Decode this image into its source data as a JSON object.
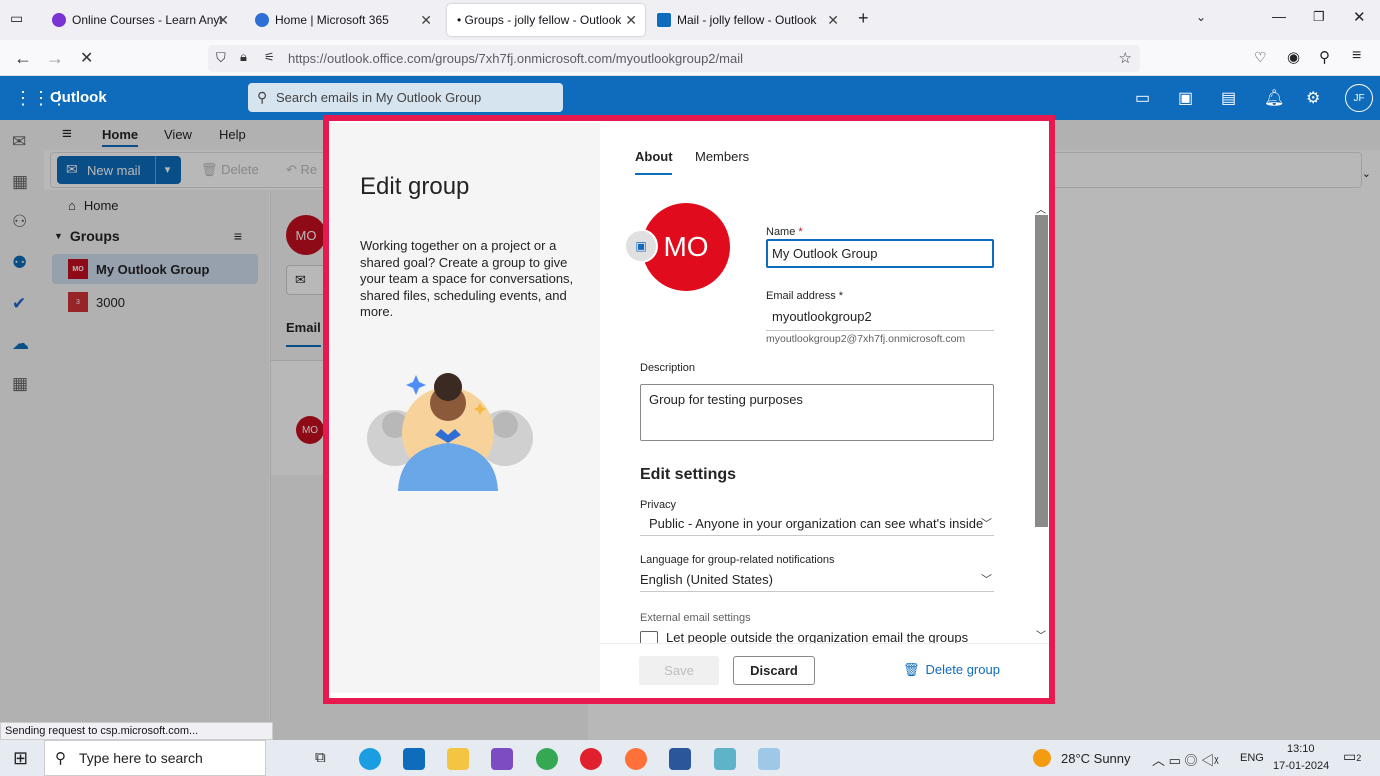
{
  "browser": {
    "tabs": [
      {
        "title": "Online Courses - Learn Anything",
        "fav": "#7b34d4"
      },
      {
        "title": "Home | Microsoft 365",
        "fav": "#2e6fd6"
      },
      {
        "title": "• Groups - jolly fellow - Outlook",
        "fav": ""
      },
      {
        "title": "Mail - jolly fellow - Outlook",
        "fav": "#0f6cbd"
      }
    ],
    "url": "https://outlook.office.com/groups/7xh7fj.onmicrosoft.com/myoutlookgroup2/mail",
    "status": "Sending request to csp.microsoft.com..."
  },
  "outlook": {
    "brand": "Outlook",
    "search_placeholder": "Search emails in My Outlook Group",
    "avatar": "JF",
    "ribbon_tabs": [
      "Home",
      "View",
      "Help"
    ],
    "new_mail": "New mail",
    "delete": "Delete",
    "reply": "Re",
    "home": "Home",
    "groups": "Groups",
    "group1": "My Outlook Group",
    "group1_badge": "MO",
    "group2": "3000",
    "group2_badge": "3",
    "email_tab": "Email",
    "mo": "MO"
  },
  "dialog": {
    "title": "Edit group",
    "description": "Working together on a project or a shared goal? Create a group to give your team a space for conversations, shared files, scheduling events, and more.",
    "tabs": [
      "About",
      "Members"
    ],
    "avatar": "MO",
    "name_label": "Name",
    "name_value": "My Outlook Group",
    "email_label": "Email address",
    "email_value": "myoutlookgroup2",
    "email_hint": "myoutlookgroup2@7xh7fj.onmicrosoft.com",
    "desc_label": "Description",
    "desc_value": "Group for testing purposes",
    "settings_title": "Edit settings",
    "privacy_label": "Privacy",
    "privacy_value": "Public - Anyone in your organization can see what's inside",
    "lang_label": "Language for group-related notifications",
    "lang_value": "English (United States)",
    "external_label": "External email settings",
    "external_option": "Let people outside the organization email the groups",
    "save": "Save",
    "discard": "Discard",
    "delete": "Delete group"
  },
  "taskbar": {
    "search": "Type here to search",
    "weather": "28°C  Sunny",
    "lang": "ENG",
    "time": "13:10",
    "date": "17-01-2024",
    "notif": "2"
  }
}
